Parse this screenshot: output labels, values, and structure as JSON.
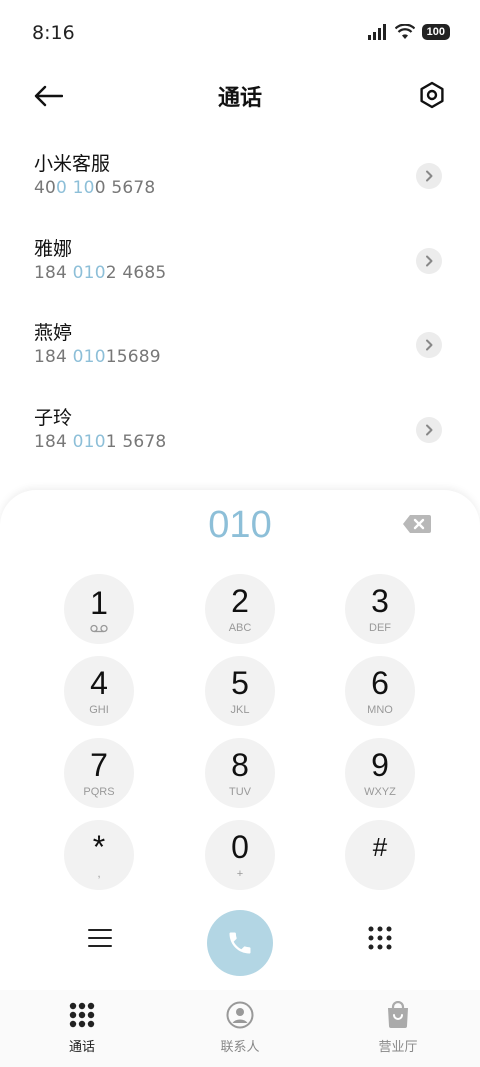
{
  "status": {
    "time": "8:16",
    "battery": "100"
  },
  "header": {
    "title": "通话"
  },
  "contacts": [
    {
      "name": "小米客服",
      "number_parts": [
        "40",
        "0 10",
        "0 5678"
      ]
    },
    {
      "name": "雅娜",
      "number_parts": [
        "184 ",
        "010",
        "2 4685"
      ]
    },
    {
      "name": "燕婷",
      "number_parts": [
        "184 ",
        "010",
        "15689"
      ]
    },
    {
      "name": "子玲",
      "number_parts": [
        "184 ",
        "010",
        "1 5678"
      ]
    }
  ],
  "dialer": {
    "display": "010",
    "keys": [
      {
        "digit": "1",
        "letters": ""
      },
      {
        "digit": "2",
        "letters": "ABC"
      },
      {
        "digit": "3",
        "letters": "DEF"
      },
      {
        "digit": "4",
        "letters": "GHI"
      },
      {
        "digit": "5",
        "letters": "JKL"
      },
      {
        "digit": "6",
        "letters": "MNO"
      },
      {
        "digit": "7",
        "letters": "PQRS"
      },
      {
        "digit": "8",
        "letters": "TUV"
      },
      {
        "digit": "9",
        "letters": "WXYZ"
      },
      {
        "digit": "*",
        "letters": ","
      },
      {
        "digit": "0",
        "letters": "+"
      },
      {
        "digit": "#",
        "letters": ""
      }
    ]
  },
  "nav": {
    "calls": "通话",
    "contacts": "联系人",
    "store": "营业厅"
  },
  "colors": {
    "accent": "#8dbfd8",
    "call_button": "#b3d6e4"
  }
}
